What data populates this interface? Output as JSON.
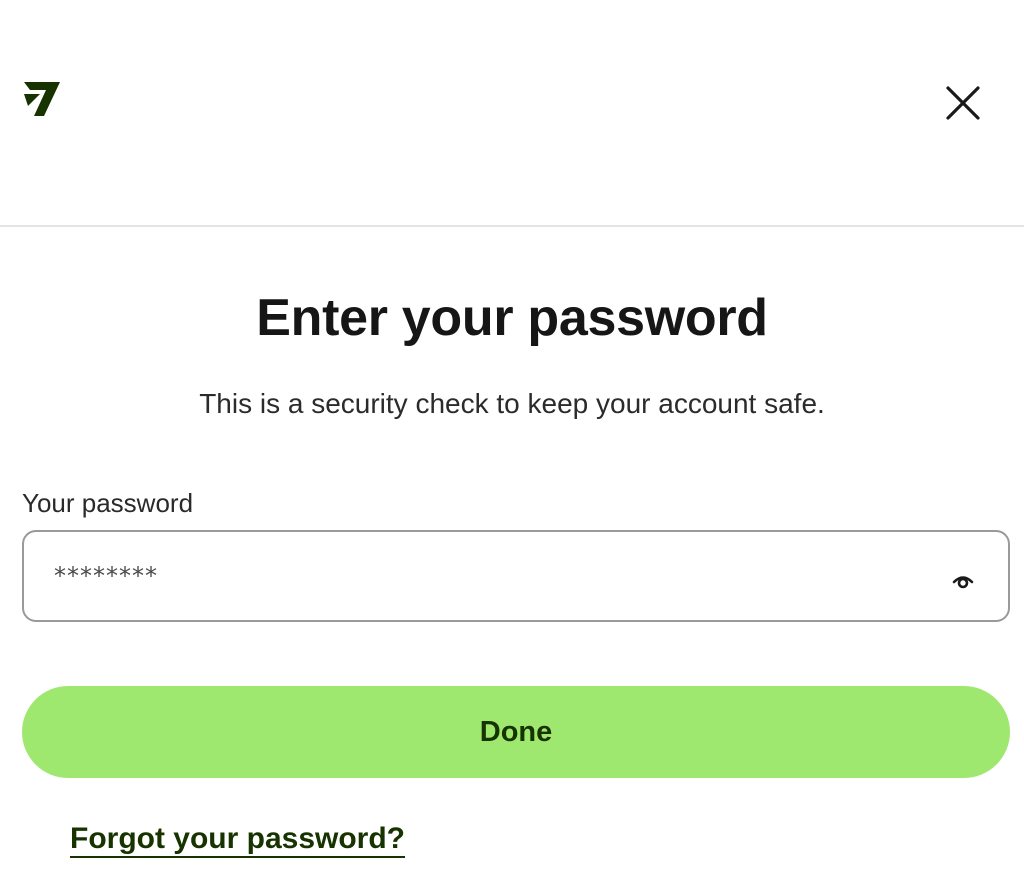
{
  "header": {
    "logo_icon": "wise-logo-icon",
    "close_icon": "close-icon"
  },
  "main": {
    "title": "Enter your password",
    "subtitle": "This is a security check to keep your account safe."
  },
  "password_field": {
    "label": "Your password",
    "value": "********",
    "visibility_icon": "eye-icon"
  },
  "actions": {
    "done_label": "Done",
    "forgot_label": "Forgot your password?"
  },
  "colors": {
    "accent": "#9fe870",
    "accent_text": "#163300",
    "text_primary": "#161616"
  }
}
